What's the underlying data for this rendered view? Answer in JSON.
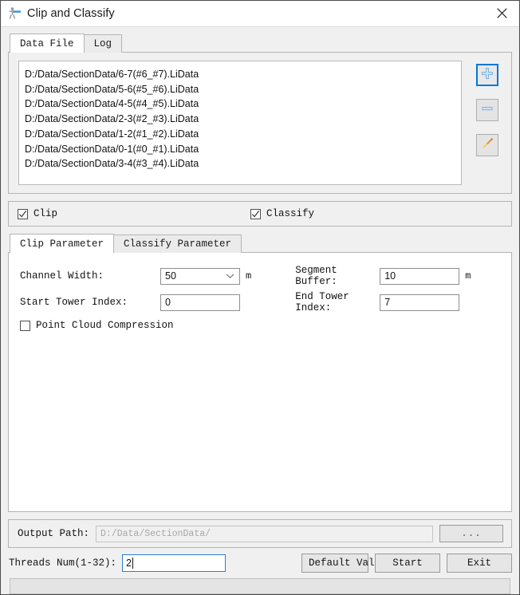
{
  "window": {
    "title": "Clip and Classify",
    "icon": "app-figure-icon",
    "close_label": "✕"
  },
  "main_tabs": [
    {
      "label": "Data File",
      "active": true
    },
    {
      "label": "Log",
      "active": false
    }
  ],
  "data_file": {
    "files": [
      "D:/Data/SectionData/6-7(#6_#7).LiData",
      "D:/Data/SectionData/5-6(#5_#6).LiData",
      "D:/Data/SectionData/4-5(#4_#5).LiData",
      "D:/Data/SectionData/2-3(#2_#3).LiData",
      "D:/Data/SectionData/1-2(#1_#2).LiData",
      "D:/Data/SectionData/0-1(#0_#1).LiData",
      "D:/Data/SectionData/3-4(#3_#4).LiData"
    ],
    "buttons": [
      {
        "name": "add-file-button",
        "icon": "plus-icon",
        "focused": true
      },
      {
        "name": "remove-file-button",
        "icon": "minus-icon",
        "focused": false
      },
      {
        "name": "clear-files-button",
        "icon": "brush-icon",
        "focused": false
      }
    ]
  },
  "enable": {
    "clip_label": "Clip",
    "clip_checked": true,
    "classify_label": "Classify",
    "classify_checked": true
  },
  "param_tabs": [
    {
      "label": "Clip Parameter",
      "active": true
    },
    {
      "label": "Classify Parameter",
      "active": false
    }
  ],
  "clip_parameter": {
    "channel_width_label": "Channel Width:",
    "channel_width_value": "50",
    "channel_width_unit": "m",
    "segment_buffer_label": "Segment Buffer:",
    "segment_buffer_value": "10",
    "segment_buffer_unit": "m",
    "start_tower_label": "Start Tower Index:",
    "start_tower_value": "0",
    "end_tower_label": "End Tower Index:",
    "end_tower_value": "7",
    "compression_label": "Point Cloud Compression",
    "compression_checked": false
  },
  "output": {
    "label": "Output Path:",
    "value": "D:/Data/SectionData/",
    "browse_label": "..."
  },
  "footer": {
    "threads_label": "Threads Num(1-32):",
    "threads_value": "2",
    "default_label": "Default Value",
    "start_label": "Start",
    "exit_label": "Exit",
    "progress_percent": 0
  },
  "colors": {
    "accent": "#0078d7",
    "window_bg": "#f0f0f0",
    "field_bg": "#ffffff"
  }
}
